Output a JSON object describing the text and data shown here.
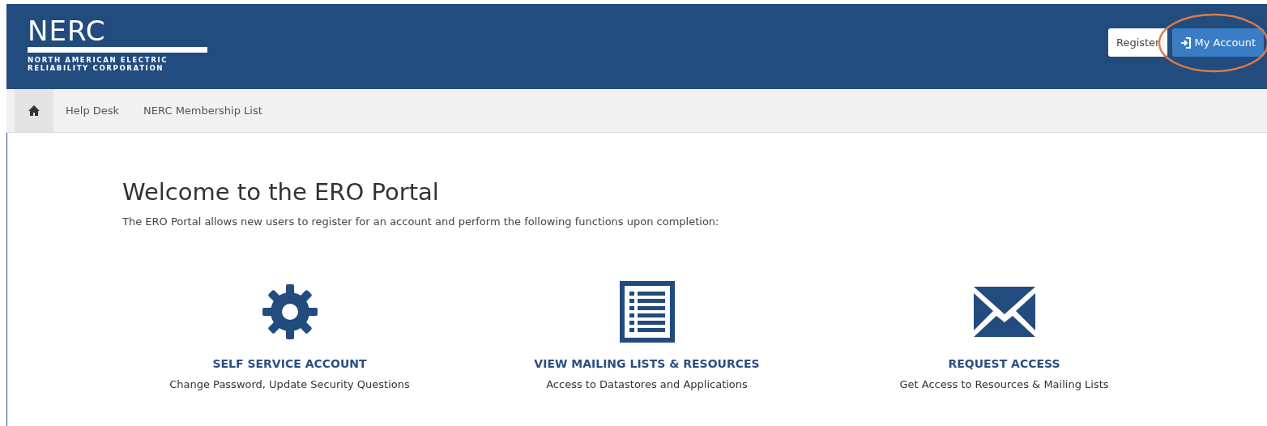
{
  "header": {
    "logo": {
      "name": "NERC",
      "subtitle_lines": [
        "NORTH AMERICAN ELECTRIC",
        "RELIABILITY CORPORATION"
      ]
    },
    "buttons": [
      {
        "label": "Register",
        "kind": "plain"
      },
      {
        "label": "My Account",
        "kind": "login"
      }
    ],
    "annotation": {
      "kind": "ellipse"
    }
  },
  "nav": {
    "items": [
      {
        "kind": "home"
      },
      {
        "kind": "link",
        "label": "Help Desk"
      },
      {
        "kind": "link",
        "label": "NERC Membership List"
      }
    ]
  },
  "welcome": {
    "title": "Welcome to the ERO Portal",
    "intro": "The ERO Portal allows new users to register for an account and perform the following functions upon completion:"
  },
  "features": [
    {
      "kind": "gear",
      "title": "SELF SERVICE ACCOUNT",
      "description": "Change Password, Update Security Questions"
    },
    {
      "kind": "list",
      "title": "VIEW MAILING LISTS & RESOURCES",
      "description": "Access to Datastores and Applications"
    },
    {
      "kind": "envelope",
      "title": "REQUEST ACCESS",
      "description": "Get Access to Resources & Mailing Lists"
    }
  ]
}
